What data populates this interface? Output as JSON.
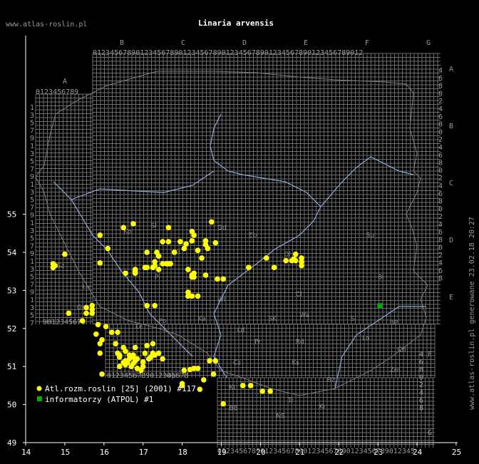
{
  "header": {
    "site": "www.atlas-roslin.pl",
    "title": "Linaria arvensis",
    "vertical_note": "www.atlas-roslin.pl generowane 23.02.18 20:27"
  },
  "axes": {
    "x_ticks": [
      "14",
      "15",
      "16",
      "17",
      "18",
      "19",
      "20",
      "21",
      "22",
      "23",
      "24",
      "25"
    ],
    "y_ticks": [
      "49",
      "50",
      "51",
      "52",
      "53",
      "54",
      "55"
    ]
  },
  "grid": {
    "top_letters": [
      "B",
      "C",
      "D",
      "E",
      "F",
      "G"
    ],
    "left_letter": "A",
    "right_letters": [
      "A",
      "B",
      "C",
      "D",
      "E"
    ],
    "bottom_right_letters": [
      "F",
      "G"
    ],
    "top_digits": "0123456789012345678901234567890123456789012345678901234567890123456789",
    "left_top_digits": "0123456789",
    "bottom_digits": "0123456789012345678901234567890123456789012345",
    "lower_left_digits": "9012345678",
    "lower_left_row": "0123456789012345678",
    "left_col_digits": [
      "1",
      "3",
      "5",
      "7",
      "9",
      "1",
      "3",
      "5",
      "7",
      "9",
      "1",
      "3",
      "5",
      "7",
      "9",
      "1",
      "3",
      "5",
      "7",
      "9",
      "1",
      "3",
      "5",
      "7",
      "9",
      "1",
      "3",
      "5",
      "7"
    ],
    "right_col_digits": [
      "4",
      "6",
      "8",
      "0",
      "2",
      "4",
      "6",
      "8",
      "0",
      "2",
      "4",
      "6",
      "8",
      "0",
      "2",
      "4",
      "6",
      "8",
      "0",
      "2",
      "4",
      "6",
      "8",
      "0",
      "2",
      "4",
      "6",
      "8"
    ],
    "lower_right_digits": [
      "4",
      "6",
      "8",
      "0",
      "2",
      "4",
      "6",
      "8"
    ]
  },
  "regions": [
    "Ko",
    "Gd",
    "Sl",
    "Eb",
    "Ol",
    "Su",
    "Sz",
    "Pi",
    "Bi",
    "Cl",
    "Lu",
    "Gs",
    "Ki",
    "Lo",
    "Wa",
    "Le",
    "SK",
    "Po",
    "Ld",
    "Pr",
    "Rd",
    "Si",
    "BP",
    "Wr",
    "Op",
    "Kt",
    "Cz",
    "Tr",
    "Ch",
    "Zm",
    "Ks",
    "Kr",
    "NS",
    "Rz",
    "BB",
    "Wl",
    "Ka"
  ],
  "legend": {
    "items": [
      {
        "label": "Atl.rozm.roslin [25] (2001) #117",
        "color": "#ffff00",
        "shape": "circle"
      },
      {
        "label": "informatorzy (ATPOL) #1",
        "color": "#00aa00",
        "shape": "square"
      }
    ]
  },
  "map_data": {
    "yellow_points_lonlat": [
      [
        15.9,
        54.45
      ],
      [
        16.5,
        54.65
      ],
      [
        16.75,
        54.75
      ],
      [
        17.65,
        54.65
      ],
      [
        18.25,
        54.55
      ],
      [
        18.3,
        54.45
      ],
      [
        18.75,
        54.8
      ],
      [
        18.6,
        54.3
      ],
      [
        18.25,
        54.3
      ],
      [
        17.5,
        54.28
      ],
      [
        17.65,
        54.28
      ],
      [
        17.95,
        54.28
      ],
      [
        18.1,
        54.22
      ],
      [
        18.65,
        54.1
      ],
      [
        18.85,
        54.25
      ],
      [
        18.6,
        54.2
      ],
      [
        16.1,
        54.1
      ],
      [
        15.0,
        53.95
      ],
      [
        17.1,
        54.0
      ],
      [
        17.35,
        54.0
      ],
      [
        17.4,
        53.9
      ],
      [
        17.8,
        54.0
      ],
      [
        18.05,
        54.1
      ],
      [
        18.4,
        54.05
      ],
      [
        18.5,
        53.85
      ],
      [
        17.3,
        53.75
      ],
      [
        17.5,
        53.7
      ],
      [
        17.6,
        53.7
      ],
      [
        17.65,
        53.7
      ],
      [
        17.7,
        53.7
      ],
      [
        17.3,
        53.65
      ],
      [
        17.4,
        53.55
      ],
      [
        16.8,
        53.55
      ],
      [
        16.8,
        53.5
      ],
      [
        16.8,
        53.45
      ],
      [
        16.55,
        53.45
      ],
      [
        17.05,
        53.6
      ],
      [
        17.1,
        53.6
      ],
      [
        17.25,
        53.6
      ],
      [
        18.15,
        53.55
      ],
      [
        18.3,
        53.45
      ],
      [
        18.25,
        53.4
      ],
      [
        18.25,
        53.35
      ],
      [
        18.3,
        53.35
      ],
      [
        18.6,
        53.4
      ],
      [
        18.9,
        53.3
      ],
      [
        19.05,
        53.3
      ],
      [
        19.7,
        53.6
      ],
      [
        20.15,
        53.85
      ],
      [
        20.35,
        53.6
      ],
      [
        20.65,
        53.78
      ],
      [
        20.8,
        53.78
      ],
      [
        20.9,
        53.78
      ],
      [
        20.9,
        53.95
      ],
      [
        21.05,
        53.75
      ],
      [
        21.05,
        53.65
      ],
      [
        20.85,
        53.82
      ],
      [
        21.05,
        53.85
      ],
      [
        14.7,
        53.6
      ],
      [
        14.75,
        53.65
      ],
      [
        14.7,
        53.7
      ],
      [
        15.9,
        53.72
      ],
      [
        18.15,
        52.85
      ],
      [
        18.25,
        52.85
      ],
      [
        18.4,
        52.85
      ],
      [
        18.15,
        52.95
      ],
      [
        17.1,
        52.6
      ],
      [
        17.3,
        52.6
      ],
      [
        15.55,
        52.55
      ],
      [
        15.7,
        52.5
      ],
      [
        15.7,
        52.6
      ],
      [
        15.7,
        52.4
      ],
      [
        15.55,
        52.4
      ],
      [
        15.1,
        52.4
      ],
      [
        15.45,
        52.2
      ],
      [
        15.85,
        52.1
      ],
      [
        16.05,
        52.05
      ],
      [
        16.35,
        51.9
      ],
      [
        16.2,
        51.9
      ],
      [
        15.8,
        51.85
      ],
      [
        15.95,
        51.7
      ],
      [
        16.3,
        51.6
      ],
      [
        16.5,
        51.5
      ],
      [
        17.1,
        51.55
      ],
      [
        17.25,
        51.6
      ],
      [
        16.8,
        51.5
      ],
      [
        16.55,
        51.4
      ],
      [
        16.4,
        51.3
      ],
      [
        16.4,
        51.25
      ],
      [
        16.55,
        51.15
      ],
      [
        16.6,
        51.1
      ],
      [
        16.65,
        51.2
      ],
      [
        16.75,
        51.25
      ],
      [
        16.75,
        51.3
      ],
      [
        16.65,
        51.3
      ],
      [
        16.85,
        51.2
      ],
      [
        16.8,
        51.15
      ],
      [
        16.55,
        51.05
      ],
      [
        16.4,
        51.0
      ],
      [
        16.7,
        51.0
      ],
      [
        16.85,
        50.95
      ],
      [
        17.0,
        51.0
      ],
      [
        17.15,
        51.2
      ],
      [
        17.2,
        51.25
      ],
      [
        17.25,
        51.35
      ],
      [
        17.3,
        51.3
      ],
      [
        17.4,
        51.35
      ],
      [
        17.05,
        51.35
      ],
      [
        16.95,
        50.9
      ],
      [
        17.5,
        51.2
      ],
      [
        18.05,
        50.9
      ],
      [
        18.2,
        50.92
      ],
      [
        18.3,
        50.95
      ],
      [
        18.4,
        50.95
      ],
      [
        18.0,
        50.5
      ],
      [
        18.0,
        50.55
      ],
      [
        18.55,
        50.65
      ],
      [
        18.7,
        51.15
      ],
      [
        18.85,
        51.15
      ],
      [
        19.05,
        50.02
      ],
      [
        18.45,
        50.4
      ],
      [
        18.8,
        50.8
      ],
      [
        19.55,
        50.5
      ],
      [
        19.75,
        50.5
      ],
      [
        20.05,
        50.35
      ],
      [
        20.25,
        50.35
      ],
      [
        15.95,
        50.8
      ],
      [
        16.75,
        51.08
      ],
      [
        16.5,
        51.1
      ],
      [
        15.9,
        51.35
      ],
      [
        15.9,
        51.6
      ],
      [
        16.35,
        51.35
      ],
      [
        17.0,
        51.12
      ]
    ],
    "green_points_lonlat": [
      [
        23.05,
        52.6
      ]
    ]
  }
}
